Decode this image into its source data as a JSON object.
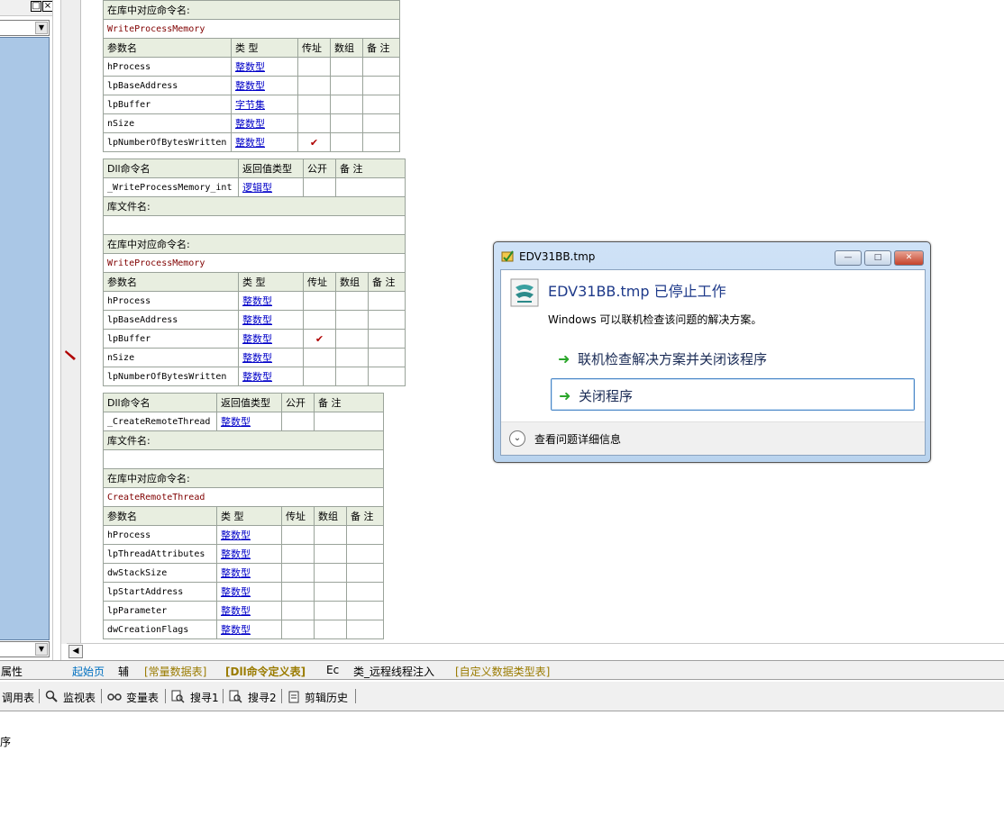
{
  "left_panel": {
    "restore_glyph": "□",
    "close_glyph": "×",
    "combo_arrow": "▼",
    "scroll_arrow": "▼"
  },
  "tables": [
    {
      "kind": "params-only",
      "lib_label": "在库中对应命令名:",
      "lib_value": "WriteProcessMemory",
      "param_headers": [
        "参数名",
        "类 型",
        "传址",
        "数组",
        "备 注"
      ],
      "params": [
        {
          "name": "hProcess",
          "type": "整数型",
          "byref": "",
          "array": "",
          "note": ""
        },
        {
          "name": "lpBaseAddress",
          "type": "整数型",
          "byref": "",
          "array": "",
          "note": ""
        },
        {
          "name": "lpBuffer",
          "type": "字节集",
          "byref": "",
          "array": "",
          "note": ""
        },
        {
          "name": "nSize",
          "type": "整数型",
          "byref": "",
          "array": "",
          "note": ""
        },
        {
          "name": "lpNumberOfBytesWritten",
          "type": "整数型",
          "byref": "✔",
          "array": "",
          "note": ""
        }
      ]
    },
    {
      "kind": "full",
      "dll_headers": [
        "Dll命令名",
        "返回值类型",
        "公开",
        "备 注"
      ],
      "dll_name": "_WriteProcessMemory_int",
      "return_type": "逻辑型",
      "lib_file_label": "库文件名:",
      "lib_file_value": "",
      "lib_label": "在库中对应命令名:",
      "lib_value": "WriteProcessMemory",
      "param_headers": [
        "参数名",
        "类 型",
        "传址",
        "数组",
        "备 注"
      ],
      "params": [
        {
          "name": "hProcess",
          "type": "整数型",
          "byref": "",
          "array": "",
          "note": ""
        },
        {
          "name": "lpBaseAddress",
          "type": "整数型",
          "byref": "",
          "array": "",
          "note": ""
        },
        {
          "name": "lpBuffer",
          "type": "整数型",
          "byref": "✔",
          "array": "",
          "note": ""
        },
        {
          "name": "nSize",
          "type": "整数型",
          "byref": "",
          "array": "",
          "note": ""
        },
        {
          "name": "lpNumberOfBytesWritten",
          "type": "整数型",
          "byref": "",
          "array": "",
          "note": ""
        }
      ]
    },
    {
      "kind": "full",
      "dll_headers": [
        "Dll命令名",
        "返回值类型",
        "公开",
        "备 注"
      ],
      "dll_name": "_CreateRemoteThread",
      "return_type": "整数型",
      "lib_file_label": "库文件名:",
      "lib_file_value": "",
      "lib_label": "在库中对应命令名:",
      "lib_value": "CreateRemoteThread",
      "param_headers": [
        "参数名",
        "类 型",
        "传址",
        "数组",
        "备 注"
      ],
      "params": [
        {
          "name": "hProcess",
          "type": "整数型",
          "byref": "",
          "array": "",
          "note": ""
        },
        {
          "name": "lpThreadAttributes",
          "type": "整数型",
          "byref": "",
          "array": "",
          "note": ""
        },
        {
          "name": "dwStackSize",
          "type": "整数型",
          "byref": "",
          "array": "",
          "note": ""
        },
        {
          "name": "lpStartAddress",
          "type": "整数型",
          "byref": "",
          "array": "",
          "note": ""
        },
        {
          "name": "lpParameter",
          "type": "整数型",
          "byref": "",
          "array": "",
          "note": ""
        },
        {
          "name": "dwCreationFlags",
          "type": "整数型",
          "byref": "",
          "array": "",
          "note": ""
        }
      ]
    }
  ],
  "hscroll": {
    "left_arrow": "◀"
  },
  "tabs": {
    "properties": "属性",
    "items": [
      "起始页",
      "辅",
      "[常量数据表]",
      "[Dll命令定义表]",
      "Ec",
      "类_远程线程注入",
      "[自定义数据类型表]"
    ]
  },
  "toolbar": {
    "items": [
      {
        "icon": "",
        "label": "调用表"
      },
      {
        "icon": "magnifier-icon",
        "label": "监视表"
      },
      {
        "icon": "glasses-icon",
        "label": "变量表"
      },
      {
        "icon": "find-icon",
        "label": "搜寻1"
      },
      {
        "icon": "find-icon",
        "label": "搜寻2"
      },
      {
        "icon": "clipboard-icon",
        "label": "剪辑历史"
      }
    ]
  },
  "output": {
    "text": "序"
  },
  "dialog": {
    "title": "EDV31BB.tmp",
    "headline": "EDV31BB.tmp 已停止工作",
    "description": "Windows 可以联机检查该问题的解决方案。",
    "option_online": "联机检查解决方案并关闭该程序",
    "option_close": "关闭程序",
    "details": "查看问题详细信息",
    "min_glyph": "—",
    "max_glyph": "□",
    "close_glyph": "✕",
    "arrow_glyph": "➜",
    "chevron_glyph": "⌄"
  }
}
